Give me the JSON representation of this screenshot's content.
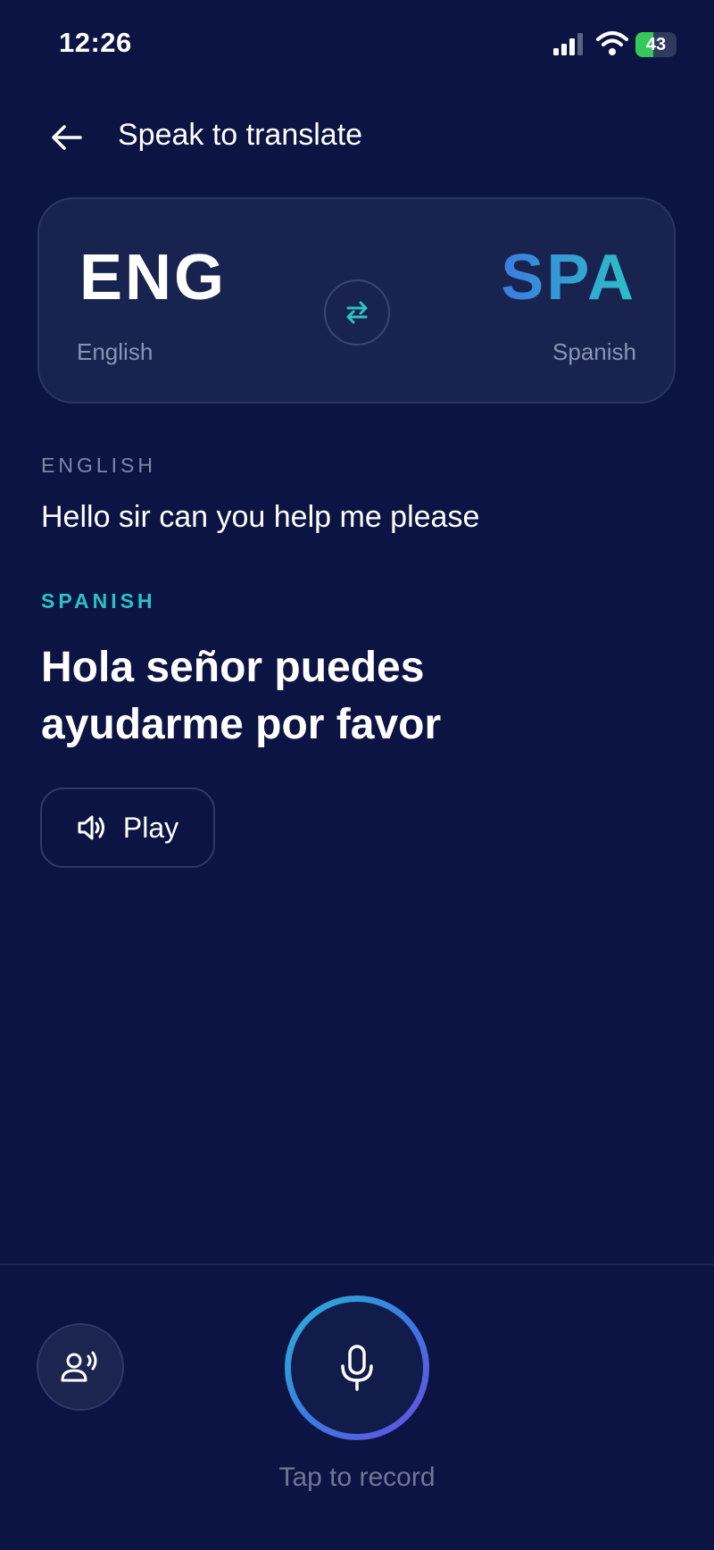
{
  "status_bar": {
    "time": "12:26",
    "battery_percent": "43",
    "battery_level": 0.43,
    "battery_charging": true,
    "colors": {
      "battery_fill": "#34c759"
    }
  },
  "header": {
    "title": "Speak to translate",
    "back_icon": "arrow-left-icon"
  },
  "language_selector": {
    "source": {
      "code": "ENG",
      "name": "English"
    },
    "target": {
      "code": "SPA",
      "name": "Spanish"
    },
    "swap_icon": "swap-arrows-icon"
  },
  "transcript": {
    "source_label": "ENGLISH",
    "source_text": "Hello sir can you help me please",
    "target_label": "SPANISH",
    "target_text": "Hola señor puedes ayudarme por favor"
  },
  "play_button": {
    "label": "Play",
    "icon": "speaker-icon"
  },
  "bottom": {
    "conversation_icon": "voice-person-icon",
    "record_icon": "microphone-icon",
    "record_hint": "Tap to record"
  },
  "colors": {
    "background": "#0b1442",
    "card": "#19234f",
    "accent_teal": "#2bc2c6",
    "accent_blue": "#3b7be0",
    "accent_purple": "#6a4be0"
  }
}
